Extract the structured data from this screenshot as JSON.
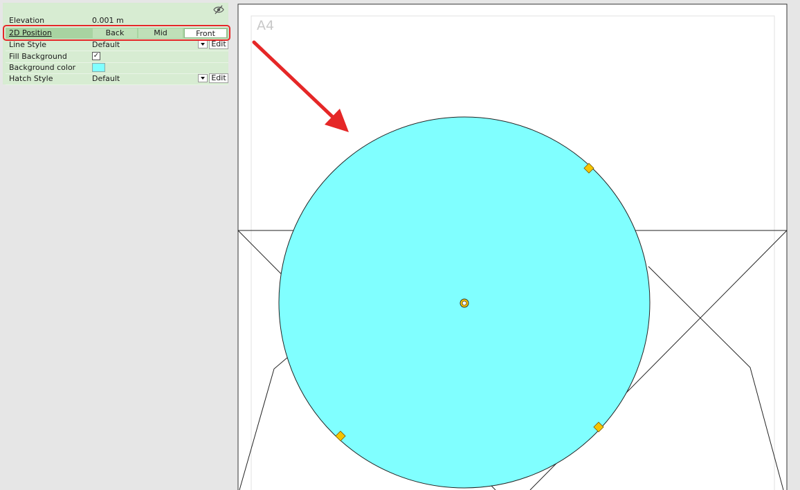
{
  "properties": {
    "elevation": {
      "label": "Elevation",
      "value": "0.001 m"
    },
    "position_2d": {
      "label": "2D Position",
      "options": [
        "Back",
        "Mid",
        "Front"
      ],
      "selected": "Front"
    },
    "line_style": {
      "label": "Line Style",
      "value": "Default",
      "edit_label": "Edit"
    },
    "fill_background": {
      "label": "Fill Background",
      "checked": true,
      "check_mark": "✓"
    },
    "background_color": {
      "label": "Background color",
      "color": "#80ffff"
    },
    "hatch_style": {
      "label": "Hatch Style",
      "value": "Default",
      "edit_label": "Edit"
    }
  },
  "canvas": {
    "page_label": "A4",
    "circle_fill": "#80ffff",
    "handle_color": "#f5c400",
    "annotation_color": "#e52727"
  },
  "icons": {
    "visibility": "eye-slash-icon"
  }
}
